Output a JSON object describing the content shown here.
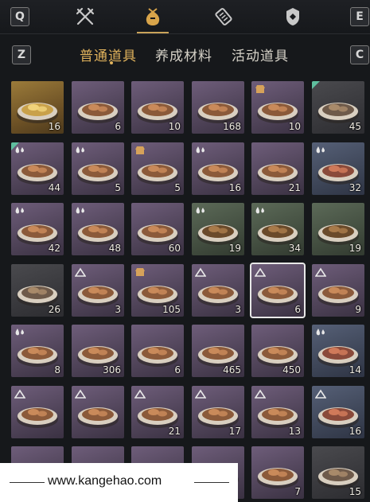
{
  "hotkeys": {
    "prev_category": "Q",
    "next_category": "E",
    "prev_tab": "Z",
    "next_tab": "C"
  },
  "categories": [
    {
      "icon": "crossed-swords-icon",
      "active": false
    },
    {
      "icon": "pouch-icon",
      "active": true
    },
    {
      "icon": "scroll-icon",
      "active": false
    },
    {
      "icon": "badge-icon",
      "active": false
    }
  ],
  "tabs": [
    {
      "label": "普通道具",
      "active": true
    },
    {
      "label": "养成材料",
      "active": false
    },
    {
      "label": "活动道具",
      "active": false
    }
  ],
  "colors": {
    "accent": "#e0b25c",
    "selected_border": "#e8e8e8",
    "new_corner": "#5fbf9f"
  },
  "items": [
    {
      "icon": "gold-ingot-icon",
      "count": "16",
      "quality": "gold",
      "badge": "",
      "new": false
    },
    {
      "icon": "jade-cake-icon",
      "count": "6",
      "quality": "purple",
      "badge": "",
      "new": false
    },
    {
      "icon": "stew-bowl-icon",
      "count": "10",
      "quality": "purple",
      "badge": "",
      "new": false
    },
    {
      "icon": "clay-pot-dish-icon",
      "count": "168",
      "quality": "purple",
      "badge": "",
      "new": false
    },
    {
      "icon": "shaved-ice-icon",
      "count": "10",
      "quality": "purple",
      "badge": "stall",
      "new": false
    },
    {
      "icon": "steamed-buns-icon",
      "count": "45",
      "quality": "gray",
      "badge": "",
      "new": true
    },
    {
      "icon": "steamed-buns-icon",
      "count": "44",
      "quality": "purple",
      "badge": "drops",
      "new": true
    },
    {
      "icon": "porridge-bowl-icon",
      "count": "5",
      "quality": "purple",
      "badge": "drops",
      "new": false
    },
    {
      "icon": "soup-bowl-icon",
      "count": "5",
      "quality": "purple",
      "badge": "stall",
      "new": false
    },
    {
      "icon": "braised-meat-icon",
      "count": "16",
      "quality": "purple",
      "badge": "drops",
      "new": false
    },
    {
      "icon": "wine-jar-icon",
      "count": "21",
      "quality": "purple",
      "badge": "",
      "new": false
    },
    {
      "icon": "egg-noodle-bowl-icon",
      "count": "32",
      "quality": "blue",
      "badge": "drops",
      "new": false
    },
    {
      "icon": "sliced-meat-icon",
      "count": "42",
      "quality": "purple",
      "badge": "drops",
      "new": false
    },
    {
      "icon": "vegetable-plate-icon",
      "count": "48",
      "quality": "purple",
      "badge": "drops",
      "new": false
    },
    {
      "icon": "roast-ribs-icon",
      "count": "60",
      "quality": "purple",
      "badge": "",
      "new": false
    },
    {
      "icon": "mushroom-plate-icon",
      "count": "19",
      "quality": "green",
      "badge": "drops",
      "new": false
    },
    {
      "icon": "stew-pot-icon",
      "count": "34",
      "quality": "green",
      "badge": "drops",
      "new": false
    },
    {
      "icon": "spicy-noodles-icon",
      "count": "19",
      "quality": "green",
      "badge": "",
      "new": false
    },
    {
      "icon": "meatballs-icon",
      "count": "26",
      "quality": "gray",
      "badge": "",
      "new": false
    },
    {
      "icon": "beef-bowl-icon",
      "count": "3",
      "quality": "purple",
      "badge": "mountain",
      "new": false
    },
    {
      "icon": "dumpling-plate-icon",
      "count": "105",
      "quality": "purple",
      "badge": "stall",
      "new": false
    },
    {
      "icon": "rice-bowl-icon",
      "count": "3",
      "quality": "purple",
      "badge": "mountain",
      "new": false
    },
    {
      "icon": "red-braised-icon",
      "count": "6",
      "quality": "purple",
      "badge": "mountain",
      "new": false,
      "selected": true
    },
    {
      "icon": "egg-plate-icon",
      "count": "9",
      "quality": "purple",
      "badge": "mountain",
      "new": false
    },
    {
      "icon": "lotus-root-icon",
      "count": "8",
      "quality": "purple",
      "badge": "drops",
      "new": false
    },
    {
      "icon": "chicken-leg-icon",
      "count": "306",
      "quality": "purple",
      "badge": "",
      "new": false
    },
    {
      "icon": "chicken-leg-icon",
      "count": "6",
      "quality": "purple",
      "badge": "",
      "new": false
    },
    {
      "icon": "meat-dish-icon",
      "count": "465",
      "quality": "purple",
      "badge": "",
      "new": false
    },
    {
      "icon": "fried-pieces-icon",
      "count": "450",
      "quality": "purple",
      "badge": "",
      "new": false
    },
    {
      "icon": "sliced-sausage-icon",
      "count": "14",
      "quality": "blue",
      "badge": "drops",
      "new": false
    },
    {
      "icon": "pork-belly-icon",
      "count": "",
      "quality": "purple",
      "badge": "mountain",
      "new": false
    },
    {
      "icon": "fried-tofu-icon",
      "count": "",
      "quality": "purple",
      "badge": "mountain",
      "new": false
    },
    {
      "icon": "dumplings-icon",
      "count": "21",
      "quality": "purple",
      "badge": "mountain",
      "new": false
    },
    {
      "icon": "pork-bowl-icon",
      "count": "17",
      "quality": "purple",
      "badge": "mountain",
      "new": false
    },
    {
      "icon": "pancake-plate-icon",
      "count": "13",
      "quality": "purple",
      "badge": "mountain",
      "new": false
    },
    {
      "icon": "spicy-soup-icon",
      "count": "16",
      "quality": "blue",
      "badge": "mountain",
      "new": false
    },
    {
      "icon": "porridge-bowl-icon",
      "count": "",
      "quality": "purple",
      "badge": "",
      "new": false
    },
    {
      "icon": "soup-bowl-icon",
      "count": "",
      "quality": "purple",
      "badge": "",
      "new": false
    },
    {
      "icon": "rice-bowl-icon",
      "count": "",
      "quality": "purple",
      "badge": "",
      "new": false
    },
    {
      "icon": "dumpling-plate-icon",
      "count": "",
      "quality": "purple",
      "badge": "",
      "new": false
    },
    {
      "icon": "noodle-bowl-icon",
      "count": "7",
      "quality": "purple",
      "badge": "",
      "new": false
    },
    {
      "icon": "tea-cup-icon",
      "count": "15",
      "quality": "gray",
      "badge": "",
      "new": false
    }
  ],
  "watermark": {
    "text": "www.kangehao.com"
  }
}
